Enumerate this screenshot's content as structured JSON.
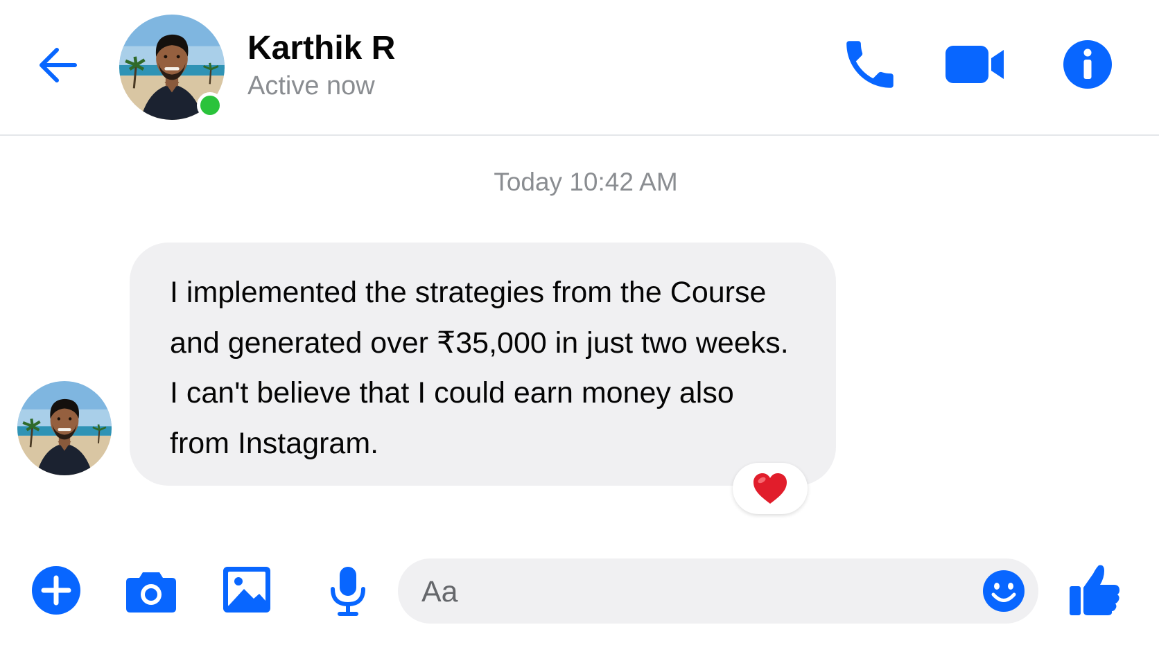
{
  "contact": {
    "name": "Karthik R",
    "status": "Active now"
  },
  "header_icons": [
    "back-arrow-icon",
    "phone-icon",
    "video-camera-icon",
    "info-icon"
  ],
  "conversation": {
    "timestamp": "Today 10:42 AM",
    "message": {
      "lines": [
        "I implemented the strategies from the Course",
        "and generated over ₹35,000 in just two weeks.",
        "I can't believe that I could earn money also",
        "from Instagram."
      ],
      "reaction": "❤️"
    }
  },
  "composer": {
    "placeholder": "Aa",
    "value": "",
    "icons": [
      "plus-icon",
      "camera-icon",
      "gallery-icon",
      "microphone-icon",
      "emoji-icon",
      "thumbs-up-icon"
    ]
  },
  "colors": {
    "accent": "#0866ff",
    "online": "#2ac33b",
    "bubble": "#f0f0f2",
    "muted_text": "#8a8d91",
    "text": "#050505"
  }
}
